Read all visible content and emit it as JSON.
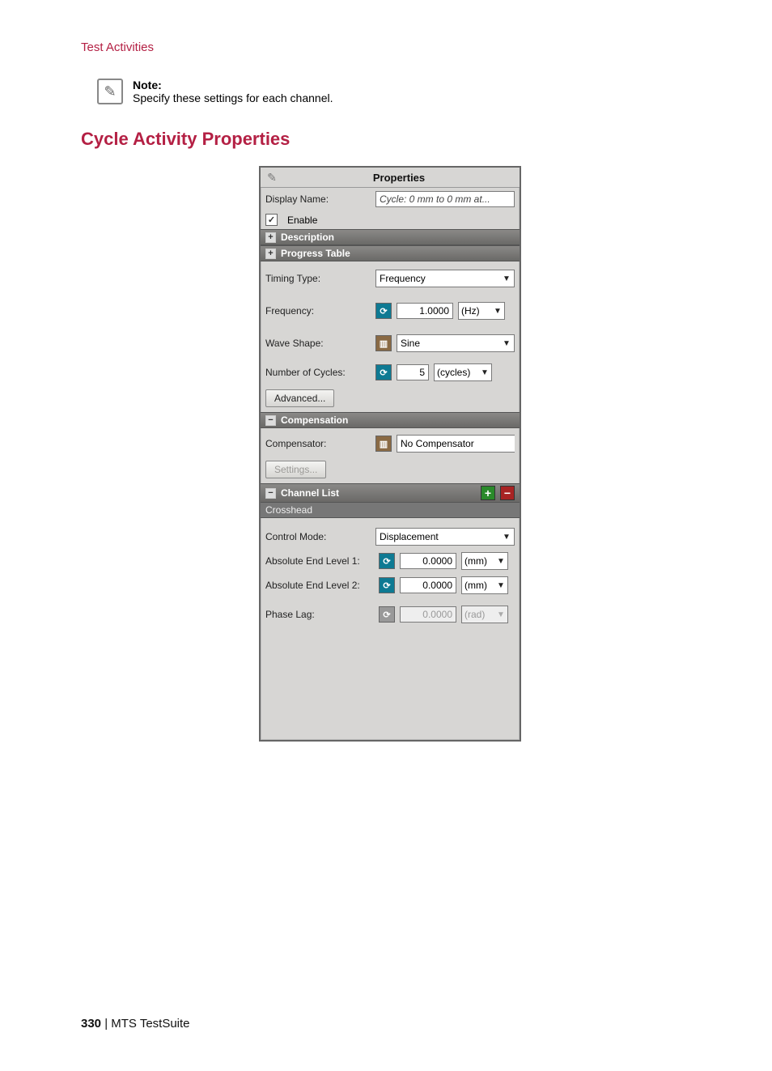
{
  "page": {
    "header": "Test Activities",
    "note_label": "Note:",
    "note_text": "Specify these settings for each channel.",
    "section_title": "Cycle Activity Properties"
  },
  "panel": {
    "title": "Properties",
    "display_name_label": "Display Name:",
    "display_name_value": "Cycle: 0 mm to 0 mm at...",
    "enable_label": "Enable",
    "enable_checked": "✓",
    "sec_description": "Description",
    "sec_progress": "Progress Table",
    "timing_label": "Timing Type:",
    "timing_value": "Frequency",
    "freq_label": "Frequency:",
    "freq_value": "1.0000",
    "freq_unit": "(Hz)",
    "wave_label": "Wave Shape:",
    "wave_value": "Sine",
    "cycles_label": "Number of Cycles:",
    "cycles_value": "5",
    "cycles_unit": "(cycles)",
    "advanced_btn": "Advanced...",
    "sec_comp": "Compensation",
    "comp_label": "Compensator:",
    "comp_value": "No Compensator",
    "settings_btn": "Settings...",
    "sec_channel": "Channel List",
    "channel_item": "Crosshead",
    "control_label": "Control Mode:",
    "control_value": "Displacement",
    "abs1_label": "Absolute End Level 1:",
    "abs1_value": "0.0000",
    "abs1_unit": "(mm)",
    "abs2_label": "Absolute End Level 2:",
    "abs2_value": "0.0000",
    "abs2_unit": "(mm)",
    "phase_label": "Phase Lag:",
    "phase_value": "0.0000",
    "phase_unit": "(rad)"
  },
  "footer": {
    "page_num": "330",
    "suite": " | MTS TestSuite"
  }
}
